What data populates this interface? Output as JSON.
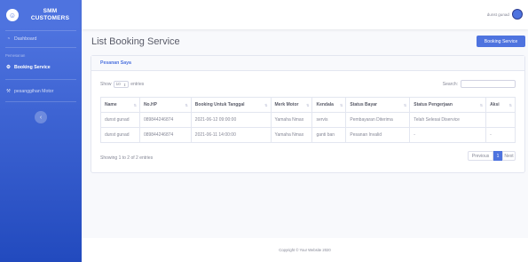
{
  "sidebar": {
    "brand": {
      "line1": "SMM",
      "line2": "CUSTOMERS",
      "icon": "smile-icon"
    },
    "dashboard": {
      "label": "Dashboard",
      "icon": "gauge-icon"
    },
    "heading": "Pemesanan",
    "items": [
      {
        "label": "Booking Service",
        "icon": "gear-icon",
        "active": true
      },
      {
        "label": "pesanggihan Motor",
        "icon": "wrench-icon",
        "active": false
      }
    ],
    "toggle_icon": "chevron-left-icon"
  },
  "topbar": {
    "user_name": "dunst gunad"
  },
  "main": {
    "title": "List Booking Service",
    "booking_button": "Booking Service",
    "card_title": "Pesanan Saya",
    "show_prefix": "Show",
    "show_value": "10",
    "show_suffix": "entries",
    "search_label": "Search:",
    "search_value": "",
    "columns": [
      "Name",
      "No.HP",
      "Booking Untuk Tanggal",
      "Merk Motor",
      "Kendala",
      "Status Bayar",
      "Status Pengerjaan",
      "Aksi"
    ],
    "rows": [
      [
        "dunst gunad",
        "089844246874",
        "2021-06-12 09:00:00",
        "Yamaha Nmax",
        "servis",
        "Pembayaran Diterima",
        "Telah Selesai Diservice",
        ""
      ],
      [
        "dunst gunad",
        "089844246874",
        "2021-06-11 14:00:00",
        "Yamaha Nmax",
        "ganti ban",
        "Pesanan Invalid",
        "-",
        "-"
      ]
    ],
    "info": "Showing 1 to 2 of 2 entries",
    "pagination": {
      "previous": "Previous",
      "page": "1",
      "next": "Next"
    }
  },
  "footer": {
    "text": "Copyright © Your Website 2020"
  },
  "colors": {
    "primary": "#4e73df",
    "sidebar_dark": "#224abe",
    "text": "#858796"
  }
}
